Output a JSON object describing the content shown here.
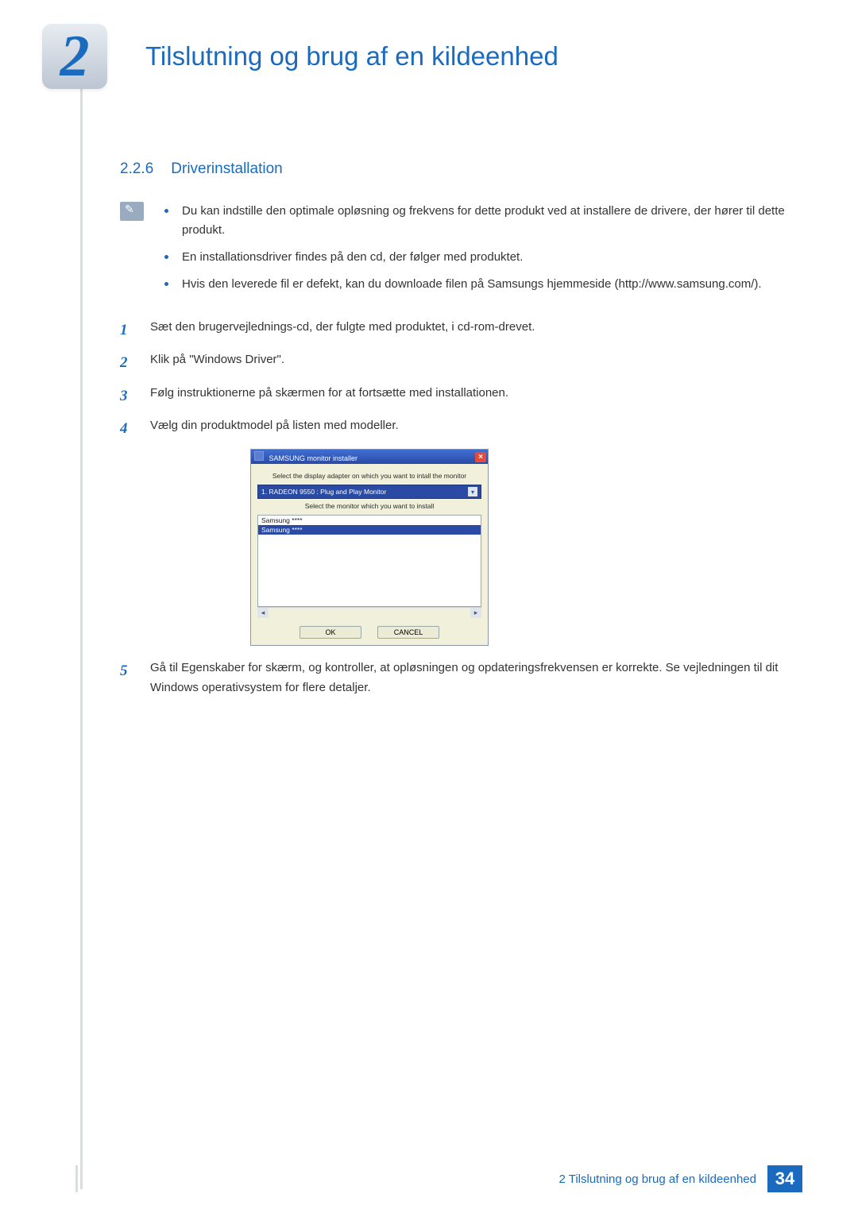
{
  "chapter": {
    "number": "2",
    "title": "Tilslutning og brug af en kildeenhed"
  },
  "section": {
    "number": "2.2.6",
    "title": "Driverinstallation"
  },
  "note": {
    "bullets": [
      "Du kan indstille den optimale opløsning og frekvens for dette produkt ved at installere de drivere, der hører til dette produkt.",
      "En installationsdriver findes på den cd, der følger med produktet.",
      "Hvis den leverede fil er defekt, kan du downloade filen på Samsungs hjemmeside (http://www.samsung.com/)."
    ]
  },
  "steps": [
    {
      "n": "1",
      "text": "Sæt den brugervejlednings-cd, der fulgte med produktet, i cd-rom-drevet."
    },
    {
      "n": "2",
      "text": "Klik på \"Windows Driver\"."
    },
    {
      "n": "3",
      "text": "Følg instruktionerne på skærmen for at fortsætte med installationen."
    },
    {
      "n": "4",
      "text": "Vælg din produktmodel på listen med modeller."
    },
    {
      "n": "5",
      "text": "Gå til Egenskaber for skærm, og kontroller, at opløsningen og opdateringsfrekvensen er korrekte. Se vejledningen til dit Windows operativsystem for flere detaljer."
    }
  ],
  "installer": {
    "title": "SAMSUNG monitor installer",
    "prompt1": "Select the display adapter on which you want to intall the monitor",
    "adapter": "1. RADEON 9550 : Plug and Play Monitor",
    "prompt2": "Select the monitor which you want to install",
    "list": [
      "Samsung ****",
      "Samsung ****"
    ],
    "ok": "OK",
    "cancel": "CANCEL"
  },
  "footer": {
    "text": "2 Tilslutning og brug af en kildeenhed",
    "page": "34"
  }
}
